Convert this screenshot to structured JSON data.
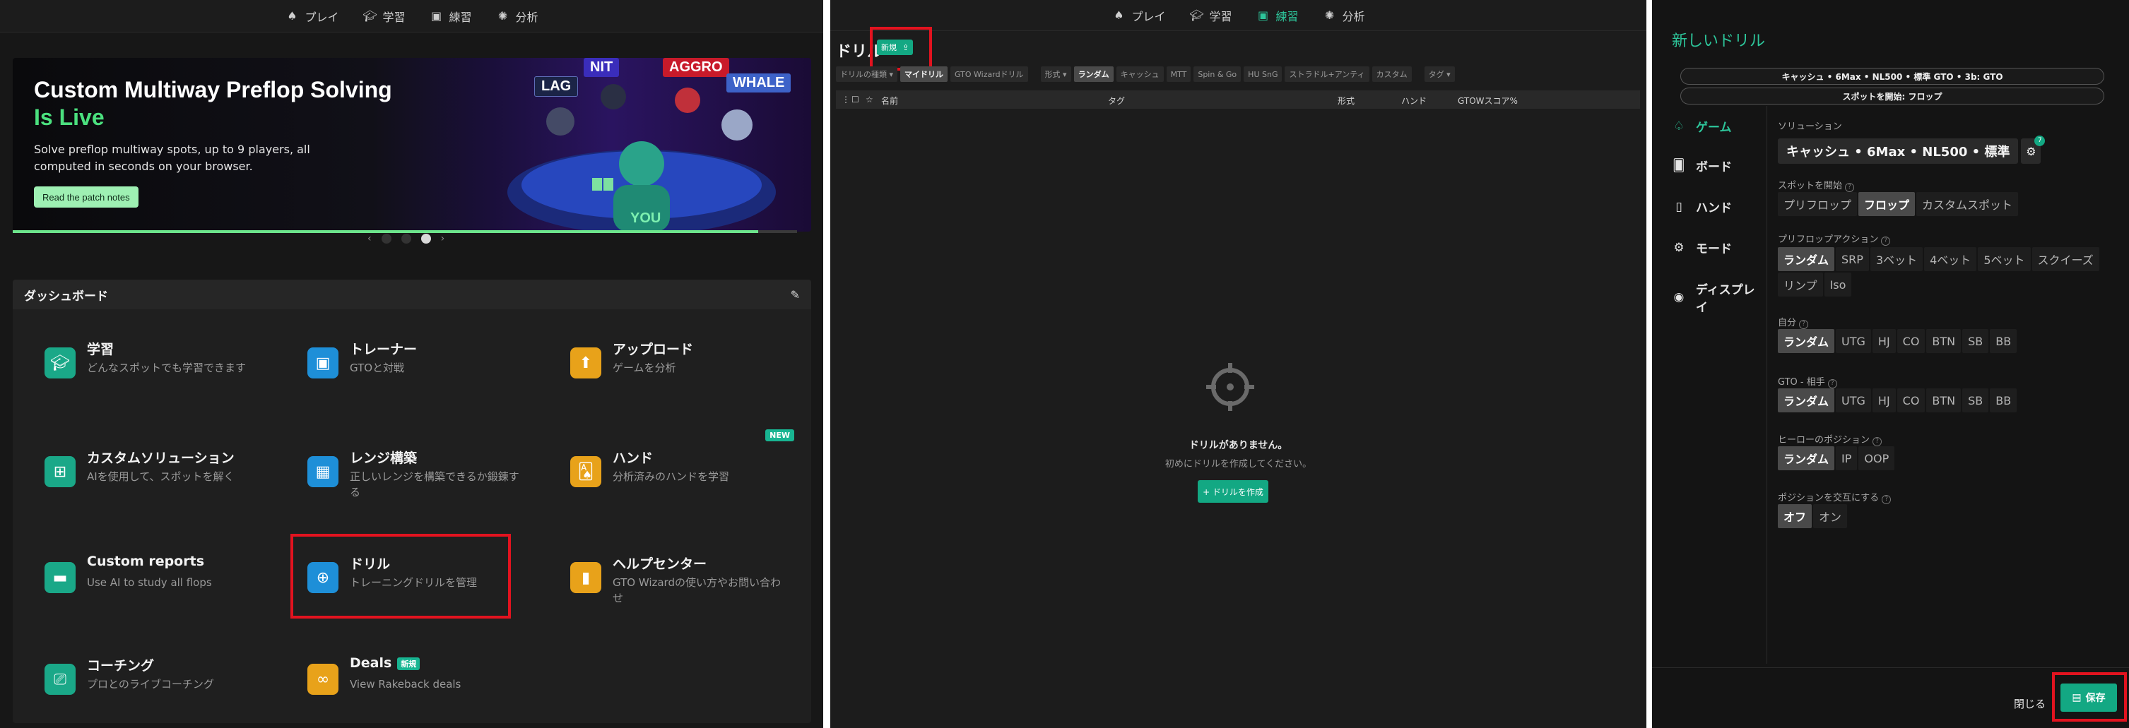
{
  "nav": {
    "play": "プレイ",
    "learn": "学習",
    "practice": "練習",
    "analyze": "分析"
  },
  "banner": {
    "title_line1": "Custom Multiway Preflop Solving",
    "title_line2": "Is Live",
    "description": "Solve preflop multiway spots, up to 9 players, all computed in seconds on your browser.",
    "button": "Read the patch notes",
    "tags": [
      "LAG",
      "NIT",
      "AGGRO",
      "WHALE",
      "YOU"
    ],
    "carousel_prev": "‹",
    "carousel_next": "›",
    "progress": 0.95
  },
  "dashboard": {
    "title": "ダッシュボード",
    "new_badge": "NEW",
    "tiles": [
      {
        "title": "学習",
        "subtitle": "どんなスポットでも学習できます",
        "color": "#1aa888"
      },
      {
        "title": "トレーナー",
        "subtitle": "GTOと対戦",
        "color": "#1e8fd8"
      },
      {
        "title": "アップロード",
        "subtitle": "ゲームを分析",
        "color": "#e8a21a"
      },
      {
        "title": "カスタムソリューション",
        "subtitle": "AIを使用して、スポットを解く",
        "color": "#1aa888"
      },
      {
        "title": "レンジ構築",
        "subtitle": "正しいレンジを構築できるか鍛錬する",
        "color": "#1e8fd8"
      },
      {
        "title": "ハンド",
        "subtitle": "分析済みのハンドを学習",
        "color": "#e8a21a"
      },
      {
        "title": "Custom reports",
        "subtitle": "Use AI to study all flops",
        "color": "#1aa888"
      },
      {
        "title": "ドリル",
        "subtitle": "トレーニングドリルを管理",
        "color": "#1e8fd8"
      },
      {
        "title": "ヘルプセンター",
        "subtitle": "GTO Wizardの使い方やお問い合わせ",
        "color": "#e8a21a"
      },
      {
        "title": "コーチング",
        "subtitle": "プロとのライブコーチング",
        "color": "#1aa888"
      },
      {
        "title": "Deals",
        "subtitle": "View Rakeback deals",
        "color": "#e8a21a",
        "badge": "新規"
      }
    ]
  },
  "drills": {
    "title": "ドリル",
    "new_button": "新規",
    "filters": [
      "ドリルの種類 ▾",
      "マイドリル",
      "GTO Wizardドリル"
    ],
    "format_filters": [
      "形式 ▾",
      "ランダム",
      "キャッシュ",
      "MTT",
      "Spin & Go",
      "HU SnG",
      "ストラドル+アンティ",
      "カスタム"
    ],
    "tag_filter": "タグ ▾",
    "columns": [
      "名前",
      "タグ",
      "形式",
      "ハンド",
      "GTOWスコア%"
    ],
    "empty_title": "ドリルがありません。",
    "empty_sub": "初めにドリルを作成してください。",
    "create_button": "+ ドリルを作成"
  },
  "new_drill": {
    "title": "新しいドリル",
    "summary1": "キャッシュ • 6Max • NL500 • 標準 GTO • 3b: GTO",
    "summary2": "スポットを開始: フロップ",
    "sidebar": [
      "ゲーム",
      "ボード",
      "ハンド",
      "モード",
      "ディスプレイ"
    ],
    "solution_label": "ソリューション",
    "solution_value": "キャッシュ • 6Max • NL500 • 標準",
    "solution_count": "7",
    "start_label": "スポットを開始",
    "start_options": [
      "プリフロップ",
      "フロップ",
      "カスタムスポット"
    ],
    "preflop_label": "プリフロップアクション",
    "preflop_options": [
      "ランダム",
      "SRP",
      "3ベット",
      "4ベット",
      "5ベット",
      "スクイーズ",
      "リンプ",
      "Iso"
    ],
    "self_label": "自分",
    "self_options": [
      "ランダム",
      "UTG",
      "HJ",
      "CO",
      "BTN",
      "SB",
      "BB"
    ],
    "opp_label": "GTO - 相手",
    "opp_options": [
      "ランダム",
      "UTG",
      "HJ",
      "CO",
      "BTN",
      "SB",
      "BB"
    ],
    "hero_label": "ヒーローのポジション",
    "hero_options": [
      "ランダム",
      "IP",
      "OOP"
    ],
    "alt_label": "ポジションを交互にする",
    "alt_options": [
      "オフ",
      "オン"
    ],
    "close": "閉じる",
    "save": "保存"
  }
}
